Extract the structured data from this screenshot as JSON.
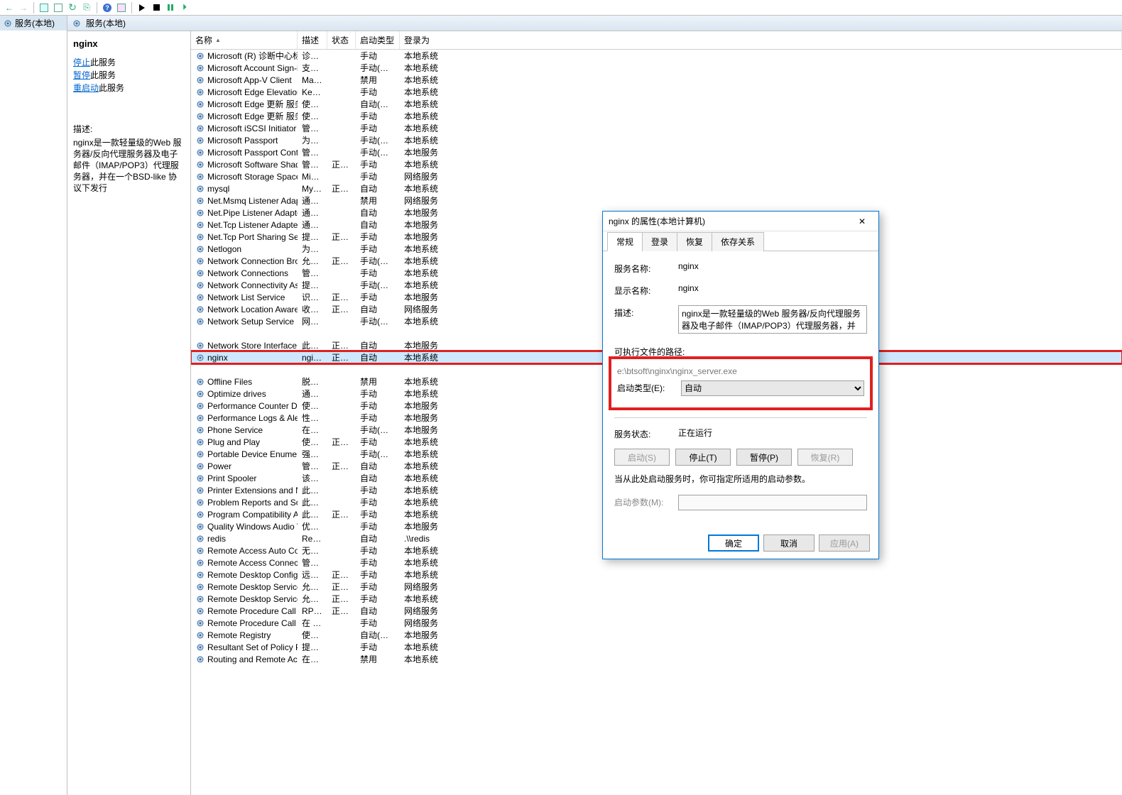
{
  "tree": {
    "root_label": "服务(本地)"
  },
  "content_header": {
    "title": "服务(本地)"
  },
  "detail": {
    "title": "nginx",
    "stop_link": "停止",
    "stop_suffix": "此服务",
    "pause_link": "暂停",
    "pause_suffix": "此服务",
    "restart_link": "重启动",
    "restart_suffix": "此服务",
    "desc_label": "描述:",
    "desc_text": "nginx是一款轻量级的Web 服务器/反向代理服务器及电子邮件（IMAP/POP3）代理服务器，并在一个BSD-like 协议下发行"
  },
  "columns": {
    "name": "名称",
    "desc": "描述",
    "status": "状态",
    "starttype": "启动类型",
    "logon": "登录为"
  },
  "services": [
    {
      "name": "Microsoft (R) 诊断中心标...",
      "desc": "诊断...",
      "status": "",
      "start": "手动",
      "logon": "本地系统"
    },
    {
      "name": "Microsoft Account Sign-i...",
      "desc": "支持...",
      "status": "",
      "start": "手动(触发...",
      "logon": "本地系统"
    },
    {
      "name": "Microsoft App-V Client",
      "desc": "Man...",
      "status": "",
      "start": "禁用",
      "logon": "本地系统"
    },
    {
      "name": "Microsoft Edge Elevation...",
      "desc": "Kee...",
      "status": "",
      "start": "手动",
      "logon": "本地系统"
    },
    {
      "name": "Microsoft Edge 更新 服务...",
      "desc": "使你...",
      "status": "",
      "start": "自动(延迟...",
      "logon": "本地系统"
    },
    {
      "name": "Microsoft Edge 更新 服务...",
      "desc": "使你...",
      "status": "",
      "start": "手动",
      "logon": "本地系统"
    },
    {
      "name": "Microsoft iSCSI Initiator ...",
      "desc": "管理...",
      "status": "",
      "start": "手动",
      "logon": "本地系统"
    },
    {
      "name": "Microsoft Passport",
      "desc": "为用...",
      "status": "",
      "start": "手动(触发...",
      "logon": "本地系统"
    },
    {
      "name": "Microsoft Passport Cont...",
      "desc": "管理...",
      "status": "",
      "start": "手动(触发...",
      "logon": "本地服务"
    },
    {
      "name": "Microsoft Software Shad...",
      "desc": "管理...",
      "status": "正在...",
      "start": "手动",
      "logon": "本地系统"
    },
    {
      "name": "Microsoft Storage Space...",
      "desc": "Micr...",
      "status": "",
      "start": "手动",
      "logon": "网络服务"
    },
    {
      "name": "mysql",
      "desc": "MyS...",
      "status": "正在...",
      "start": "自动",
      "logon": "本地系统"
    },
    {
      "name": "Net.Msmq Listener Adap...",
      "desc": "通过...",
      "status": "",
      "start": "禁用",
      "logon": "网络服务"
    },
    {
      "name": "Net.Pipe Listener Adapter",
      "desc": "通过...",
      "status": "",
      "start": "自动",
      "logon": "本地服务"
    },
    {
      "name": "Net.Tcp Listener Adapter",
      "desc": "通过...",
      "status": "",
      "start": "自动",
      "logon": "本地服务"
    },
    {
      "name": "Net.Tcp Port Sharing Ser...",
      "desc": "提供...",
      "status": "正在...",
      "start": "手动",
      "logon": "本地服务"
    },
    {
      "name": "Netlogon",
      "desc": "为用...",
      "status": "",
      "start": "手动",
      "logon": "本地系统"
    },
    {
      "name": "Network Connection Bro...",
      "desc": "允许 ...",
      "status": "正在...",
      "start": "手动(触发...",
      "logon": "本地系统"
    },
    {
      "name": "Network Connections",
      "desc": "管理...",
      "status": "",
      "start": "手动",
      "logon": "本地系统"
    },
    {
      "name": "Network Connectivity Ass...",
      "desc": "提供 ...",
      "status": "",
      "start": "手动(触发...",
      "logon": "本地系统"
    },
    {
      "name": "Network List Service",
      "desc": "识别...",
      "status": "正在...",
      "start": "手动",
      "logon": "本地服务"
    },
    {
      "name": "Network Location Aware...",
      "desc": "收集...",
      "status": "正在...",
      "start": "自动",
      "logon": "网络服务"
    },
    {
      "name": "Network Setup Service",
      "desc": "网络...",
      "status": "",
      "start": "手动(触发...",
      "logon": "本地系统"
    },
    {
      "name": "Network Store Interface ...",
      "desc": "此服...",
      "status": "正在...",
      "start": "自动",
      "logon": "本地服务",
      "pad": true
    },
    {
      "name": "nginx",
      "desc": "ngin...",
      "status": "正在...",
      "start": "自动",
      "logon": "本地系统",
      "sel": true,
      "hl": true
    },
    {
      "name": "Offline Files",
      "desc": "脱机...",
      "status": "",
      "start": "禁用",
      "logon": "本地系统",
      "pad": true
    },
    {
      "name": "Optimize drives",
      "desc": "通过...",
      "status": "",
      "start": "手动",
      "logon": "本地系统"
    },
    {
      "name": "Performance Counter DL...",
      "desc": "使远...",
      "status": "",
      "start": "手动",
      "logon": "本地服务"
    },
    {
      "name": "Performance Logs & Aler...",
      "desc": "性能...",
      "status": "",
      "start": "手动",
      "logon": "本地服务"
    },
    {
      "name": "Phone Service",
      "desc": "在设...",
      "status": "",
      "start": "手动(触发...",
      "logon": "本地服务"
    },
    {
      "name": "Plug and Play",
      "desc": "使计...",
      "status": "正在...",
      "start": "手动",
      "logon": "本地系统"
    },
    {
      "name": "Portable Device Enumera...",
      "desc": "强制...",
      "status": "",
      "start": "手动(触发...",
      "logon": "本地系统"
    },
    {
      "name": "Power",
      "desc": "管理...",
      "status": "正在...",
      "start": "自动",
      "logon": "本地系统"
    },
    {
      "name": "Print Spooler",
      "desc": "该服...",
      "status": "",
      "start": "自动",
      "logon": "本地系统"
    },
    {
      "name": "Printer Extensions and N...",
      "desc": "此服...",
      "status": "",
      "start": "手动",
      "logon": "本地系统"
    },
    {
      "name": "Problem Reports and Sol...",
      "desc": "此服...",
      "status": "",
      "start": "手动",
      "logon": "本地系统"
    },
    {
      "name": "Program Compatibility A...",
      "desc": "此服...",
      "status": "正在...",
      "start": "手动",
      "logon": "本地系统"
    },
    {
      "name": "Quality Windows Audio V...",
      "desc": "优质 ...",
      "status": "",
      "start": "手动",
      "logon": "本地服务"
    },
    {
      "name": "redis",
      "desc": "Redi...",
      "status": "",
      "start": "自动",
      "logon": ".\\\\redis"
    },
    {
      "name": "Remote Access Auto Con...",
      "desc": "无论...",
      "status": "",
      "start": "手动",
      "logon": "本地系统"
    },
    {
      "name": "Remote Access Connecti...",
      "desc": "管理...",
      "status": "",
      "start": "手动",
      "logon": "本地系统"
    },
    {
      "name": "Remote Desktop Configu...",
      "desc": "远程...",
      "status": "正在...",
      "start": "手动",
      "logon": "本地系统"
    },
    {
      "name": "Remote Desktop Services",
      "desc": "允许...",
      "status": "正在...",
      "start": "手动",
      "logon": "网络服务"
    },
    {
      "name": "Remote Desktop Service...",
      "desc": "允许...",
      "status": "正在...",
      "start": "手动",
      "logon": "本地系统"
    },
    {
      "name": "Remote Procedure Call (...",
      "desc": "RPC...",
      "status": "正在...",
      "start": "自动",
      "logon": "网络服务"
    },
    {
      "name": "Remote Procedure Call (...",
      "desc": "在 W...",
      "status": "",
      "start": "手动",
      "logon": "网络服务"
    },
    {
      "name": "Remote Registry",
      "desc": "使远...",
      "status": "",
      "start": "自动(触发...",
      "logon": "本地服务"
    },
    {
      "name": "Resultant Set of Policy Pr...",
      "desc": "提供...",
      "status": "",
      "start": "手动",
      "logon": "本地系统"
    },
    {
      "name": "Routing and Remote Acc...",
      "desc": "在局...",
      "status": "",
      "start": "禁用",
      "logon": "本地系统"
    }
  ],
  "dialog": {
    "title": "nginx 的属性(本地计算机)",
    "tabs": [
      "常规",
      "登录",
      "恢复",
      "依存关系"
    ],
    "svc_name_lbl": "服务名称:",
    "svc_name_val": "nginx",
    "disp_name_lbl": "显示名称:",
    "disp_name_val": "nginx",
    "desc_lbl": "描述:",
    "desc_val": "nginx是一款轻量级的Web 服务器/反向代理服务器及电子邮件（IMAP/POP3）代理服务器，并在一个",
    "path_lbl": "可执行文件的路径:",
    "path_val": "e:\\btsoft\\nginx\\nginx_server.exe",
    "starttype_lbl": "启动类型(E):",
    "starttype_val": "自动",
    "status_lbl": "服务状态:",
    "status_val": "正在运行",
    "btn_start": "启动(S)",
    "btn_stop": "停止(T)",
    "btn_pause": "暂停(P)",
    "btn_resume": "恢复(R)",
    "note": "当从此处启动服务时，你可指定所适用的启动参数。",
    "startparam_lbl": "启动参数(M):",
    "btn_ok": "确定",
    "btn_cancel": "取消",
    "btn_apply": "应用(A)"
  }
}
